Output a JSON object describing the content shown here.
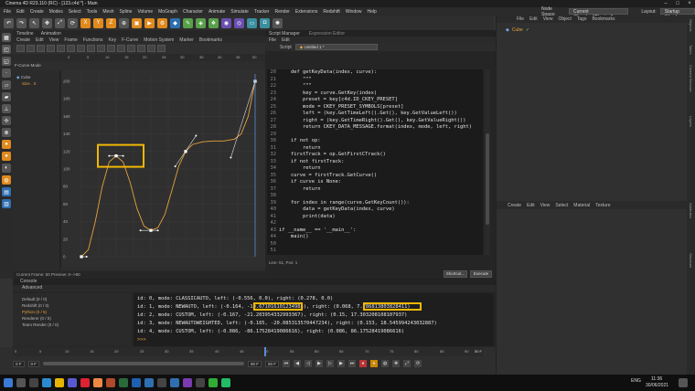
{
  "window": {
    "title": "Cinema 4D R23.110 (RC) - [123.c4d *] - Main"
  },
  "menubar": {
    "items": [
      "File",
      "Edit",
      "Create",
      "Modes",
      "Select",
      "Tools",
      "Mesh",
      "Spline",
      "Volume",
      "MoGraph",
      "Character",
      "Animate",
      "Simulate",
      "Tracker",
      "Render",
      "Extensions",
      "Redshift",
      "Window",
      "Help"
    ],
    "node_space_label": "Node Space:",
    "node_space_value": "Current (Standard/Physical)",
    "layout_label": "Layout:",
    "layout_value": "Startup (User)"
  },
  "timeline": {
    "tabs": [
      "Timeline",
      "Animation"
    ],
    "menu": [
      "Create",
      "Edit",
      "View",
      "Frame",
      "Functions",
      "Key",
      "F-Curve",
      "Motion System",
      "Marker",
      "Bookmarks"
    ],
    "ruler": [
      "0",
      "5",
      "10",
      "15",
      "20",
      "25",
      "30",
      "35",
      "40",
      "45",
      "50"
    ],
    "mode_label": "F-Curve Mode",
    "tree_items": [
      "Cube",
      "Size . X"
    ],
    "y_ticks": [
      "200",
      "180",
      "160",
      "140",
      "120",
      "100",
      "80",
      "60",
      "40",
      "20",
      "0"
    ],
    "status": "Current Frame: 50  Preview: 0-->90"
  },
  "script_manager": {
    "tabs": [
      "Script Manager",
      "Expression Editor"
    ],
    "menu": [
      "File",
      "Edit"
    ],
    "script_label": "Script",
    "script_value": "Untitled 1 *",
    "line_col": "Line: 51, Pos: 1",
    "shortcut_label": "Shortcut...",
    "execute_label": "Execute",
    "code_lines": [
      {
        "n": "20",
        "t": "    def getKeyData(index, curve):"
      },
      {
        "n": "21",
        "t": "        \"\"\""
      },
      {
        "n": "22",
        "t": "        \"\"\""
      },
      {
        "n": "23",
        "t": "        key = curve.GetKey(index)"
      },
      {
        "n": "24",
        "t": "        preset = key[c4d.ID_CKEY_PRESET]"
      },
      {
        "n": "25",
        "t": "        mode = CKEY_PRESET_SYMBOLS[preset]"
      },
      {
        "n": "26",
        "t": "        left = (key.GetTimeLeft().Get(), key.GetValueLeft())"
      },
      {
        "n": "27",
        "t": "        right = (key.GetTimeRight().Get(), key.GetValueRight())"
      },
      {
        "n": "28",
        "t": "        return CKEY_DATA_MESSAGE.format(index, mode, left, right)"
      },
      {
        "n": "29",
        "t": ""
      },
      {
        "n": "30",
        "t": "    if not op:"
      },
      {
        "n": "31",
        "t": "        return"
      },
      {
        "n": "32",
        "t": "    firstTrack = op.GetFirstCTrack()"
      },
      {
        "n": "33",
        "t": "    if not firstTrack:"
      },
      {
        "n": "34",
        "t": "        return"
      },
      {
        "n": "35",
        "t": "    curve = firstTrack.GetCurve()"
      },
      {
        "n": "36",
        "t": "    if curve is None:"
      },
      {
        "n": "37",
        "t": "        return"
      },
      {
        "n": "38",
        "t": ""
      },
      {
        "n": "39",
        "t": "    for index in range(curve.GetKeyCount()):"
      },
      {
        "n": "40",
        "t": "        data = getKeyData(index, curve)"
      },
      {
        "n": "41",
        "t": "        print(data)"
      },
      {
        "n": "42",
        "t": ""
      },
      {
        "n": "43",
        "t": "if __name__ == '__main__':"
      },
      {
        "n": "44",
        "t": "    main()"
      },
      {
        "n": "50",
        "t": ""
      },
      {
        "n": "51",
        "t": ""
      }
    ]
  },
  "objects": {
    "menu": [
      "File",
      "Edit",
      "View",
      "Object",
      "Tags",
      "Bookmarks"
    ],
    "object_name": "Cube"
  },
  "attributes": {
    "menu": [
      "Create",
      "Edit",
      "View",
      "Select",
      "Material",
      "Texture"
    ]
  },
  "right_vtabs": [
    "Objects",
    "Takes",
    "Content Browser",
    "Layers",
    "Attributes",
    "Structure"
  ],
  "console": {
    "tab": "Console",
    "section": "Advanced",
    "list": [
      "Default (0 / 0)",
      "Redshift (0 / 0)",
      "Python (0 / 5)",
      "Renderer (0 / 0)",
      "Team Render (0 / 0)"
    ],
    "output": [
      "id: 0, mode: CLASSICAUTO, left: (-0.556, 0.0), right: (0.278, 0.0)",
      "id: 1, mode: NEWAUTO, left: (-0.164, -10.671016101234985), right: (0.068, 7.786813803828411)",
      "id: 2, mode: CUSTOM, left: (-0.167, -21.203954332993367), right: (0.15, 17.303208108107937)",
      "id: 3, mode: NEWAUTOWEIGHTED, left: (-0.165, -20.085313570447234), right: (0.153, 18.545994243032887)",
      "id: 4, mode: CUSTOM, left: (-0.086, -86.17528419086616), right: (0.086, 86.17528419086616)",
      ">>>"
    ]
  },
  "bottom_timeline": {
    "ruler": [
      "0",
      "5",
      "10",
      "15",
      "20",
      "25",
      "30",
      "35",
      "40",
      "45",
      "50",
      "55",
      "60",
      "65",
      "70",
      "75",
      "80",
      "85",
      "90"
    ],
    "current_frame": "50 F",
    "start_field": "0 F",
    "start_field_2": "0 F",
    "end_field": "90 F",
    "end_field_2": "90 F"
  },
  "taskbar": {
    "time": "11:36",
    "date": "30/06/2021",
    "lang": "ENG"
  },
  "chart_data": {
    "type": "line",
    "title": "",
    "xlabel": "",
    "ylabel": "",
    "xlim": [
      0,
      50
    ],
    "ylim": [
      0,
      200
    ],
    "keys": [
      {
        "x": 0,
        "y": 0
      },
      {
        "x": 10,
        "y": 115
      },
      {
        "x": 20,
        "y": 30
      },
      {
        "x": 30,
        "y": 120
      },
      {
        "x": 50,
        "y": 200
      }
    ],
    "curve": [
      [
        0,
        0
      ],
      [
        2,
        8
      ],
      [
        4,
        40
      ],
      [
        6,
        80
      ],
      [
        8,
        108
      ],
      [
        10,
        115
      ],
      [
        12,
        108
      ],
      [
        14,
        85
      ],
      [
        16,
        55
      ],
      [
        18,
        35
      ],
      [
        20,
        30
      ],
      [
        22,
        33
      ],
      [
        24,
        48
      ],
      [
        26,
        75
      ],
      [
        28,
        103
      ],
      [
        30,
        120
      ],
      [
        32,
        128
      ],
      [
        35,
        131
      ],
      [
        38,
        132
      ],
      [
        41,
        132
      ],
      [
        44,
        134
      ],
      [
        46,
        140
      ],
      [
        48,
        160
      ],
      [
        50,
        200
      ]
    ],
    "tangents": [
      [
        [
          0,
          0
        ],
        [
          1.5,
          0
        ]
      ],
      [
        [
          8,
          115
        ],
        [
          12,
          115
        ]
      ],
      [
        [
          17,
          30
        ],
        [
          22,
          30
        ]
      ],
      [
        [
          27,
          103
        ],
        [
          33,
          138
        ]
      ],
      [
        [
          43,
          113
        ],
        [
          50,
          200
        ]
      ]
    ]
  }
}
